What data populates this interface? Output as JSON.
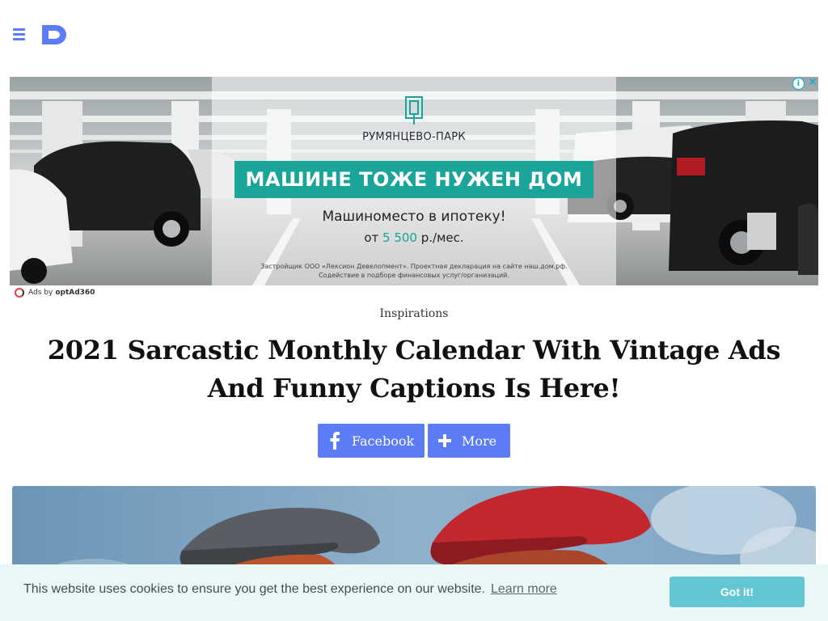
{
  "header": {
    "menu_icon": "hamburger-icon",
    "logo_icon": "site-logo-d-icon",
    "accent_color": "#5b7cf5"
  },
  "ad": {
    "brand": "РУМЯНЦЕВО-ПАРК",
    "headline": "МАШИНЕ ТОЖЕ НУЖЕН ДОМ",
    "subline": "Машиноместо в ипотеку!",
    "price_prefix": "от",
    "price_value": "5 500",
    "price_suffix": "р./мес.",
    "legal_line1": "Застройщик ООО «Лексион Девелопмент». Проектная декларация на сайте наш.дом.рф.",
    "legal_line2": "Содействие в подборе финансовых услуг/организаций.",
    "info_label": "i",
    "close_label": "✕",
    "accent_color": "#1aa49a"
  },
  "ads_by": {
    "prefix": "Ads by",
    "provider": "optAd360"
  },
  "article": {
    "category": "Inspirations",
    "title": "2021 Sarcastic Monthly Calendar With Vintage Ads And Funny Captions Is Here!"
  },
  "share": {
    "facebook_label": "Facebook",
    "facebook_icon": "facebook-icon",
    "more_label": "More",
    "more_icon": "plus-icon"
  },
  "cookie": {
    "message": "This website uses cookies to ensure you get the best experience on our website.",
    "learn_more": "Learn more",
    "accept": "Got it!",
    "button_color": "#62c6d3"
  }
}
